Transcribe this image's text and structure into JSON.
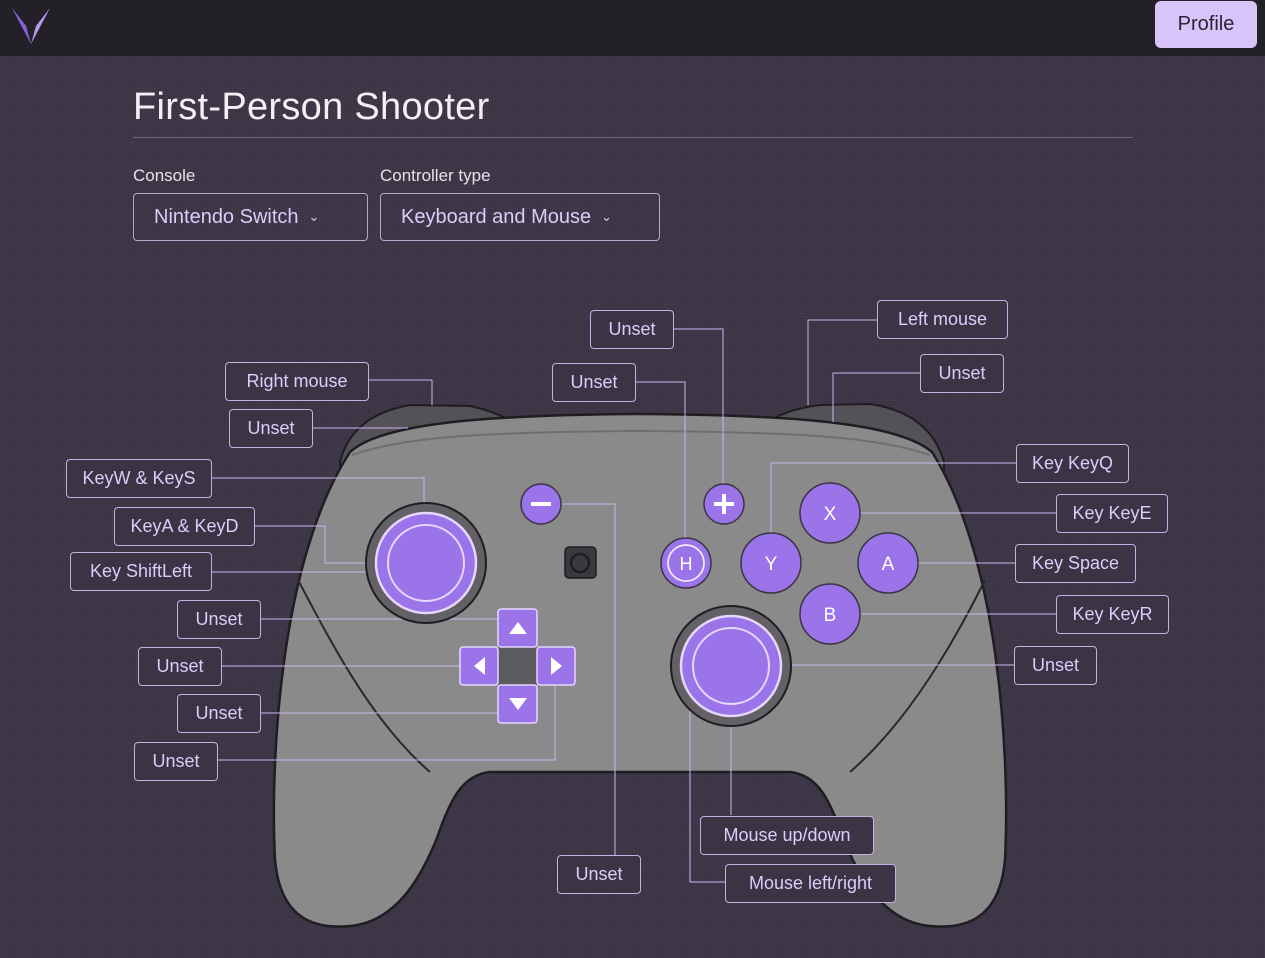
{
  "app": {
    "profile_label": "Profile",
    "logo_icon": "v-logo-icon"
  },
  "page": {
    "title": "First-Person Shooter"
  },
  "selectors": {
    "console": {
      "label": "Console",
      "value": "Nintendo Switch"
    },
    "controller_type": {
      "label": "Controller type",
      "value": "Keyboard and Mouse"
    }
  },
  "controller": {
    "face_buttons": {
      "x": "X",
      "y": "Y",
      "a": "A",
      "b": "B",
      "home": "H"
    },
    "bindings": {
      "plus": "Unset",
      "home": "Unset",
      "minus": "Unset",
      "zr": "Left mouse",
      "r": "Unset",
      "zl": "Right mouse",
      "l": "Unset",
      "left_stick_vertical": "KeyW & KeyS",
      "left_stick_horizontal": "KeyA & KeyD",
      "left_stick_press": "Key ShiftLeft",
      "dpad_up": "Unset",
      "dpad_left": "Unset",
      "dpad_down": "Unset",
      "dpad_right": "Unset",
      "y": "Key KeyQ",
      "x": "Key KeyE",
      "a": "Key Space",
      "b": "Key KeyR",
      "right_stick_press": "Unset",
      "right_stick_vertical": "Mouse up/down",
      "right_stick_horizontal": "Mouse left/right"
    }
  },
  "colors": {
    "accent": "#9b74ea",
    "accent_light": "#d9c4fa",
    "background": "#3a3444",
    "topbar": "#232127",
    "controller_body": "#8a8a8a"
  }
}
